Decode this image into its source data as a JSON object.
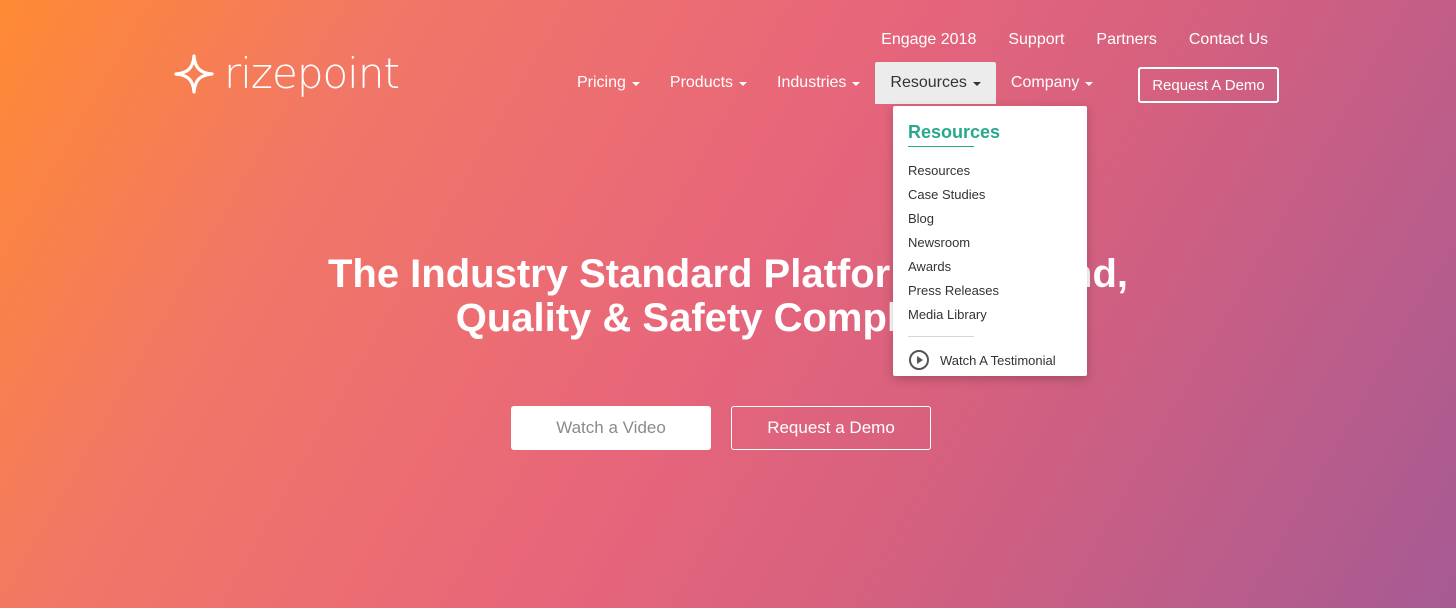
{
  "brand": {
    "name": "rizepoint"
  },
  "top_links": [
    "Engage 2018",
    "Support",
    "Partners",
    "Contact Us"
  ],
  "nav": {
    "items": [
      {
        "label": "Pricing",
        "active": false
      },
      {
        "label": "Products",
        "active": false
      },
      {
        "label": "Industries",
        "active": false
      },
      {
        "label": "Resources",
        "active": true
      },
      {
        "label": "Company",
        "active": false
      }
    ],
    "demo_button": "Request A Demo"
  },
  "dropdown": {
    "heading": "Resources",
    "items": [
      "Resources",
      "Case Studies",
      "Blog",
      "Newsroom",
      "Awards",
      "Press Releases",
      "Media Library"
    ],
    "testimonial": "Watch A Testimonial"
  },
  "hero": {
    "line1": "The Industry Standard Platform for Brand,",
    "line2": "Quality & Safety Compliance",
    "watch_button": "Watch a Video",
    "demo_button": "Request a Demo"
  },
  "colors": {
    "accent": "#2aa88f",
    "gradient_start": "#ff8a33",
    "gradient_end": "#a65a93"
  },
  "icons": {
    "logo": "sparkle-icon",
    "caret": "caret-down-icon",
    "play": "play-circle-icon"
  }
}
